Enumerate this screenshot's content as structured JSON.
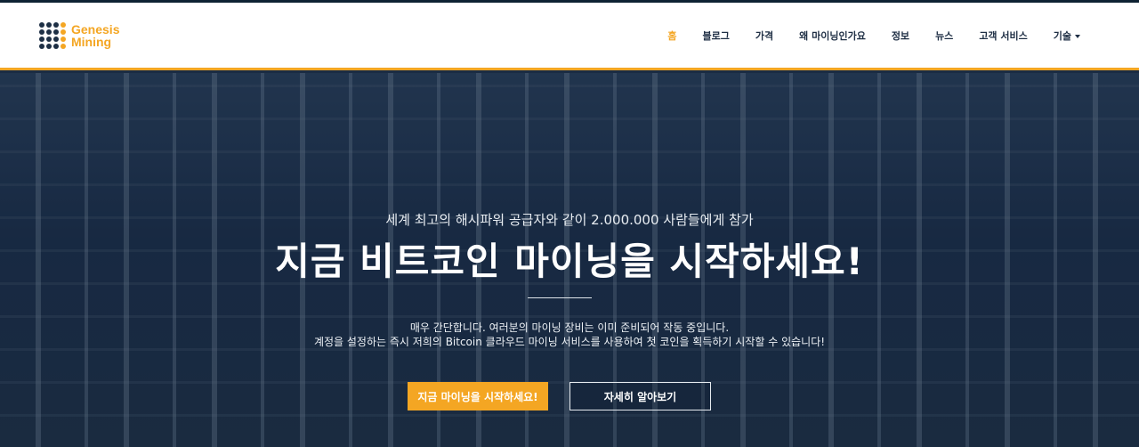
{
  "brand": {
    "line1": "Genesis",
    "line2": "Mining",
    "accent": "#f4a623",
    "dark": "#1d2f45"
  },
  "nav": {
    "items": [
      {
        "label": "홈",
        "active": true
      },
      {
        "label": "블로그"
      },
      {
        "label": "가격"
      },
      {
        "label": "왜 마이닝인가요"
      },
      {
        "label": "정보"
      },
      {
        "label": "뉴스"
      },
      {
        "label": "고객 서비스"
      },
      {
        "label": "기술",
        "dropdown": true
      }
    ]
  },
  "hero": {
    "subtitle": "세계 최고의 해시파워 공급자와 같이 2.000.000 사람들에게 참가",
    "headline": "지금 비트코인 마이닝을 시작하세요!",
    "desc_line1": "매우 간단합니다. 여러분의 마이닝 장비는 이미 준비되어 작동 중입니다.",
    "desc_line2": "계정을 설정하는 즉시 저희의 Bitcoin 클라우드 마이닝 서비스를 사용하여 첫 코인을 획득하기 시작할 수 있습니다!",
    "primary_button": "지금 마이닝을 시작하세요!",
    "secondary_button": "자세히 알아보기"
  }
}
